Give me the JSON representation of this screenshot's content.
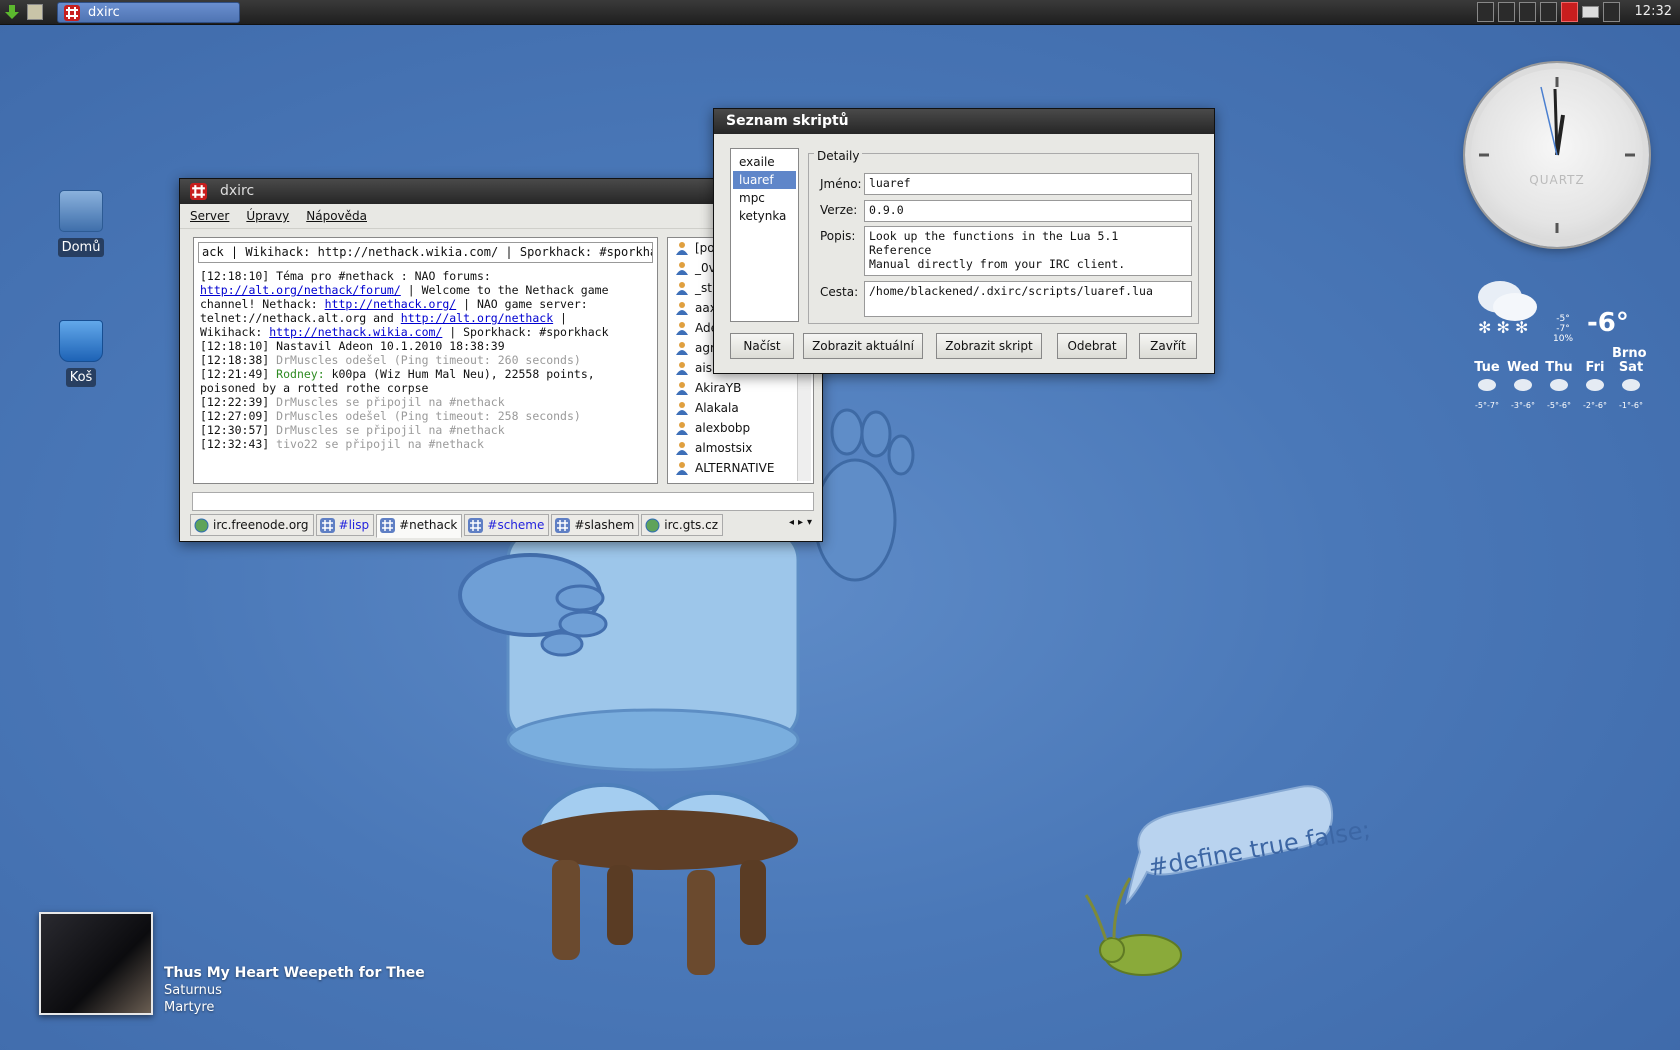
{
  "panel": {
    "taskbar_title": "dxirc",
    "clock": "12:32"
  },
  "desktop": {
    "home_label": "Domů",
    "trash_label": "Koš"
  },
  "clock_widget": {
    "brand": "QUARTZ"
  },
  "weather": {
    "small_lines": [
      "-5°",
      "-7°",
      "10%"
    ],
    "temp": "-6°",
    "city": "Brno",
    "days": [
      {
        "name": "Tue",
        "temps": "-5°-7°"
      },
      {
        "name": "Wed",
        "temps": "-3°-6°"
      },
      {
        "name": "Thu",
        "temps": "-5°-6°"
      },
      {
        "name": "Fri",
        "temps": "-2°-6°"
      },
      {
        "name": "Sat",
        "temps": "-1°-6°"
      }
    ]
  },
  "music": {
    "title": "Thus My Heart Weepeth for Thee",
    "artist": "Saturnus",
    "album": "Martyre"
  },
  "wallpaper_text": "#define true false;",
  "dxirc": {
    "title": "dxirc",
    "menu": [
      "Server",
      "Úpravy",
      "Nápověda"
    ],
    "topic": "ack | Wikihack: http://nethack.wikia.com/ | Sporkhack: #sporkhack",
    "users": [
      "[po",
      "_0v",
      "_st",
      "aax",
      "Ade",
      "agr",
      "ais523",
      "AkiraYB",
      "Alakala",
      "alexbobp",
      "almostsix",
      "ALTERNATIVE"
    ],
    "tabs": [
      {
        "label": "irc.freenode.org",
        "style": "globe"
      },
      {
        "label": "#lisp",
        "style": "blue"
      },
      {
        "label": "#nethack",
        "style": "active"
      },
      {
        "label": "#scheme",
        "style": "blue"
      },
      {
        "label": "#slashem",
        "style": "plain"
      },
      {
        "label": "irc.gts.cz",
        "style": "globe"
      }
    ],
    "messages": {
      "m1a": "[12:18:10] Téma pro #nethack : NAO forums:",
      "m1_link1": "http://alt.org/nethack/forum/",
      "m1b": " | Welcome to the Nethack game",
      "m1c": "channel! Nethack: ",
      "m1_link2": "http://nethack.org/",
      "m1d": " | NAO game server:",
      "m1e": "telnet://nethack.alt.org and ",
      "m1_link3": "http://alt.org/nethack",
      "m1f": " |",
      "m1g": "Wikihack: ",
      "m1_link4": "http://nethack.wikia.com/",
      "m1h": " | Sporkhack: #sporkhack",
      "m2": "[12:18:10] Nastavil Adeon 10.1.2010 18:38:39",
      "m3_time": "[12:18:38] ",
      "m3_text": "DrMuscles odešel (Ping timeout: 260 seconds)",
      "m4_time": "[12:21:49] ",
      "m4_nick": "Rodney:",
      "m4_text": " k00pa (Wiz Hum Mal Neu), 22558 points,",
      "m4_text2": "poisoned by a rotted rothe corpse",
      "m5_time": "[12:22:39] ",
      "m5_text": "DrMuscles se připojil na #nethack",
      "m6_time": "[12:27:09] ",
      "m6_text": "DrMuscles odešel (Ping timeout: 258 seconds)",
      "m7_time": "[12:30:57] ",
      "m7_text": "DrMuscles se připojil na #nethack",
      "m8_time": "[12:32:43] ",
      "m8_text": "tivo22 se připojil na #nethack"
    }
  },
  "scripts": {
    "title": "Seznam skriptů",
    "list": [
      "exaile",
      "luaref",
      "mpc",
      "ketynka"
    ],
    "selected": "luaref",
    "details_legend": "Detaily",
    "name_label": "Jméno:",
    "name_value": "luaref",
    "version_label": "Verze:",
    "version_value": "0.9.0",
    "desc_label": "Popis:",
    "desc_value": "Look up the functions in the Lua 5.1 Reference\nManual directly from your IRC client.",
    "path_label": "Cesta:",
    "path_value": "/home/blackened/.dxirc/scripts/luaref.lua",
    "buttons": {
      "load": "Načíst",
      "show_current": "Zobrazit aktuální",
      "show_script": "Zobrazit skript",
      "remove": "Odebrat",
      "close": "Zavřít"
    }
  },
  "colors": {
    "selection": "#5f86c9",
    "link": "#0000d0",
    "system_msg": "#9a9a9a",
    "nick": "#2e8b22",
    "tab_blue": "#2222dd"
  }
}
